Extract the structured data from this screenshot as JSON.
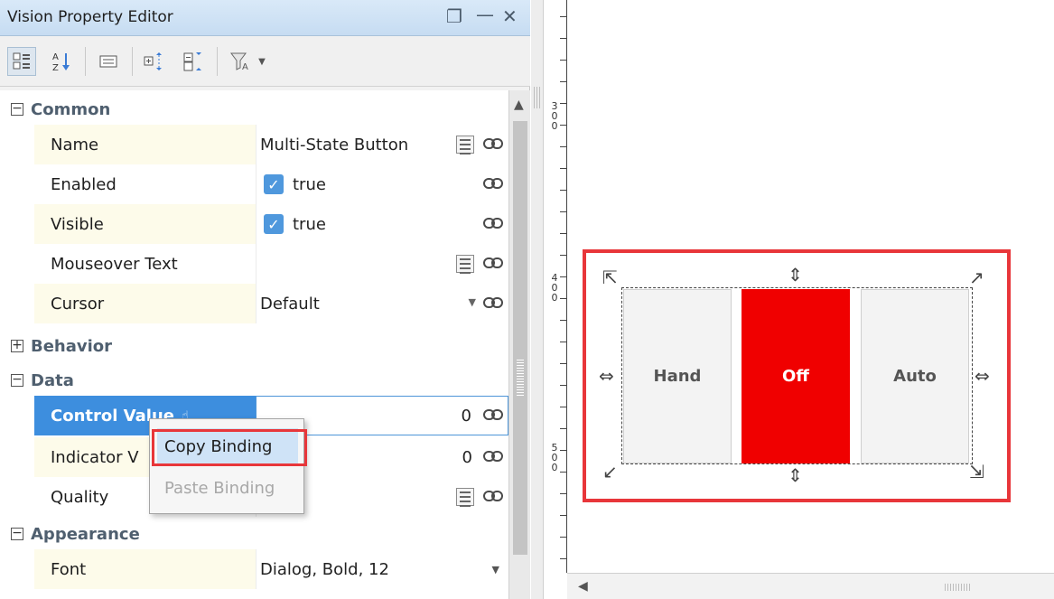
{
  "window": {
    "title": "Vision Property Editor",
    "controls": [
      "restore",
      "minimize",
      "close"
    ]
  },
  "toolbar": {
    "buttons": [
      "categorized-view",
      "alphabetical-sort",
      "properties-view",
      "expand-all",
      "collapse-all",
      "filter"
    ]
  },
  "property_grid": {
    "categories": {
      "common": "Common",
      "behavior": "Behavior",
      "data": "Data",
      "appearance": "Appearance"
    },
    "rows": {
      "name": {
        "label": "Name",
        "value": "Multi-State Button"
      },
      "enabled": {
        "label": "Enabled",
        "value": "true",
        "checked": true
      },
      "visible": {
        "label": "Visible",
        "value": "true",
        "checked": true
      },
      "mouseover": {
        "label": "Mouseover Text",
        "value": ""
      },
      "cursor": {
        "label": "Cursor",
        "value": "Default"
      },
      "control_value": {
        "label": "Control Value",
        "value": "0"
      },
      "indicator_value": {
        "label": "Indicator V",
        "value": "0"
      },
      "quality": {
        "label": "Quality",
        "value": ""
      },
      "font": {
        "label": "Font",
        "value": "Dialog, Bold, 12"
      }
    }
  },
  "context_menu": {
    "copy": "Copy Binding",
    "paste": "Paste Binding",
    "paste_enabled": false
  },
  "ruler": {
    "labels": [
      "3\n0\n0",
      "4\n0\n0",
      "5\n0\n0"
    ]
  },
  "component": {
    "type": "Multi-State Button",
    "states": [
      {
        "label": "Hand",
        "active": false
      },
      {
        "label": "Off",
        "active": true
      },
      {
        "label": "Auto",
        "active": false
      }
    ],
    "active_color": "#f00000"
  },
  "colors": {
    "highlight": "#e8363a",
    "selection": "#3d8ede",
    "titlebar": "#c6dcf2"
  }
}
